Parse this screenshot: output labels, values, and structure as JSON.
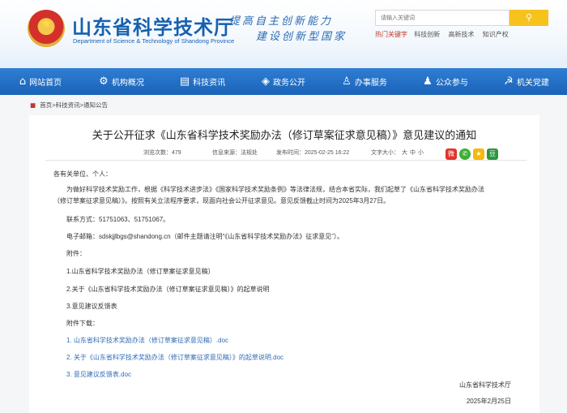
{
  "header": {
    "site_title": "山东省科学技术厅",
    "site_subtitle": "Department of Science & Technology of Shandong Province",
    "slogan_line1": "提高自主创新能力",
    "slogan_line2": "建设创新型国家",
    "search_placeholder": "请输入关键词",
    "hot_label": "热门关键字",
    "hot_keywords": [
      "科技创新",
      "高新技术",
      "知识产权"
    ]
  },
  "nav": {
    "items": [
      {
        "label": "网站首页",
        "icon": "home-icon"
      },
      {
        "label": "机构概况",
        "icon": "gear-icon"
      },
      {
        "label": "科技资讯",
        "icon": "news-icon"
      },
      {
        "label": "政务公开",
        "icon": "layers-icon"
      },
      {
        "label": "办事服务",
        "icon": "person-icon"
      },
      {
        "label": "公众参与",
        "icon": "people-icon"
      },
      {
        "label": "机关党建",
        "icon": "party-icon"
      }
    ]
  },
  "breadcrumb": {
    "home": "首页",
    "sep": ">",
    "level2": "科技资讯",
    "level3": "通知公告"
  },
  "article": {
    "title": "关于公开征求《山东省科学技术奖励办法（修订草案征求意见稿）》意见建议的通知",
    "views": "浏览次数：479",
    "source": "信息来源：法规处",
    "date": "发布时间：2025-02-25 16:22",
    "fontsize_label": "文字大小：",
    "fontsize_options": [
      "大",
      "中",
      "小"
    ],
    "share_icons": [
      "weibo-icon",
      "wechat-icon",
      "qzone-icon",
      "douban-icon"
    ],
    "greeting": "各有关单位、个人：",
    "para1_line1": "为做好科学技术奖励工作，根据《科学技术进步法》《国家科学技术奖励条例》等法律法规，结合本省实际，我们起草了《山东省科学技术奖励办法",
    "para1_line2": "（修订草案征求意见稿）》。按照有关立法程序要求，现面向社会公开征求意见。意见反馈截止时间为2025年3月27日。",
    "contact": "联系方式：51751063、51751067。",
    "email": "电子邮箱：sdskjjlbgs@shandong.cn（邮件主题请注明“《山东省科学技术奖励办法》征求意见”）。",
    "attach_label": "附件：",
    "attachments": [
      "1.山东省科学技术奖励办法（修订草案征求意见稿）",
      "2.关于《山东省科学技术奖励办法（修订草案征求意见稿）》的起草说明",
      "3.意见建议反馈表"
    ],
    "download_label": "附件下载：",
    "downloads": [
      "1. 山东省科学技术奖励办法（修订草案征求意见稿）.doc",
      "2. 关于《山东省科学技术奖励办法（修订草案征求意见稿）》的起草说明.doc",
      "3. 意见建议反馈表.doc"
    ],
    "signature": "山东省科学技术厅",
    "sign_date": "2025年2月25日"
  }
}
